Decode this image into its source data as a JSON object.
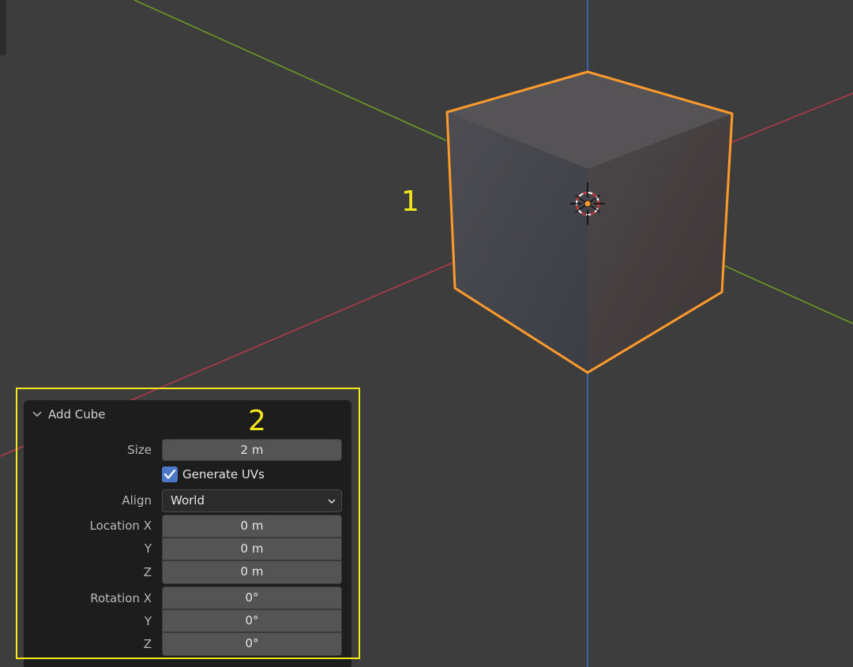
{
  "annotations": {
    "callout_1": "1",
    "callout_2": "2"
  },
  "colors": {
    "viewport_bg": "#3d3d3d",
    "selection_outline": "#ff9a2b",
    "axis_x": "#b0394a",
    "axis_y": "#6b9a23",
    "axis_z": "#3a6fc0",
    "annotation_yellow": "#f4e81c",
    "checkbox_blue": "#4b78c8"
  },
  "operator_panel": {
    "title": "Add Cube",
    "collapse_icon": "chevron-down-icon",
    "size": {
      "label": "Size",
      "value": "2 m"
    },
    "generate_uvs": {
      "label": "Generate UVs",
      "checked": true
    },
    "align": {
      "label": "Align",
      "value": "World"
    },
    "location": {
      "x_label": "Location X",
      "x_value": "0 m",
      "y_label": "Y",
      "y_value": "0 m",
      "z_label": "Z",
      "z_value": "0 m"
    },
    "rotation": {
      "x_label": "Rotation X",
      "x_value": "0°",
      "y_label": "Y",
      "y_value": "0°",
      "z_label": "Z",
      "z_value": "0°"
    }
  }
}
